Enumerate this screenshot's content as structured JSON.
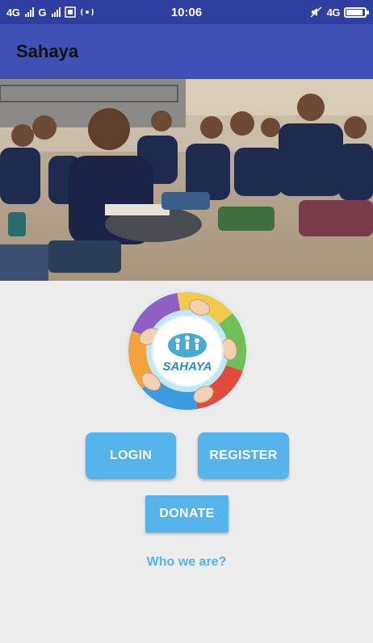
{
  "status_bar": {
    "left_signal_1": "4G",
    "left_signal_2": "G",
    "time": "10:06",
    "right_network": "4G"
  },
  "app_bar": {
    "title": "Sahaya"
  },
  "logo": {
    "text": "SAHAYA"
  },
  "actions": {
    "login_label": "LOGIN",
    "register_label": "REGISTER",
    "donate_label": "DONATE",
    "who_we_are_label": "Who we are?"
  },
  "colors": {
    "status_bar": "#2f3f9f",
    "app_bar": "#3f51b5",
    "button": "#56b4ec",
    "link": "#56b4ec",
    "background": "#ececec"
  }
}
